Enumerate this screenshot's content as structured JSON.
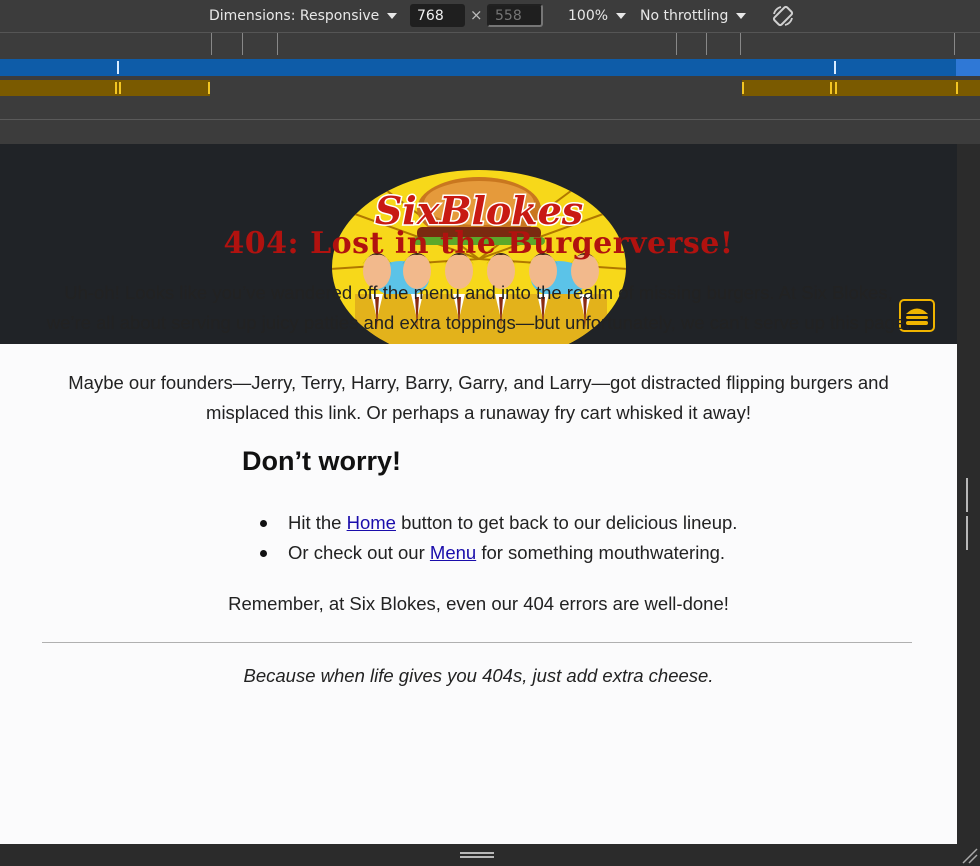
{
  "devtools": {
    "dimensions_label": "Dimensions: Responsive",
    "width_value": "768",
    "height_placeholder": "558",
    "times_symbol": "×",
    "zoom_label": "100%",
    "throttling_label": "No throttling",
    "rotate_icon": "rotate-icon"
  },
  "site": {
    "logo_text": "SixBlokes",
    "menu_icon": "burger-icon"
  },
  "content": {
    "title": "404: Lost in the Burgerverse!",
    "paragraph_1": "Uh-oh! Looks like you’ve wandered off the menu and into the realm of missing burgers. At Six Blokes, we’re all about serving up juicy patties and extra toppings—but unfortunately, we can’t serve up this page.",
    "paragraph_2": "Maybe our founders—Jerry, Terry, Harry, Barry, Garry, and Larry—got distracted flipping burgers and misplaced this link. Or perhaps a runaway fry cart whisked it away!",
    "heading": "Don’t worry!",
    "list": [
      {
        "before": "Hit the ",
        "link": "Home",
        "after": " button to get back to our delicious lineup."
      },
      {
        "before": "Or check out our ",
        "link": "Menu",
        "after": " for something mouthwatering."
      }
    ],
    "remember": "Remember, at Six Blokes, even our 404 errors are well-done!",
    "tagline": "Because when life gives you 404s, just add extra cheese."
  },
  "colors": {
    "title_red": "#b1120f",
    "header_bg": "#202327",
    "accent_gold": "#f0b400",
    "link_blue": "#1a0dab"
  }
}
